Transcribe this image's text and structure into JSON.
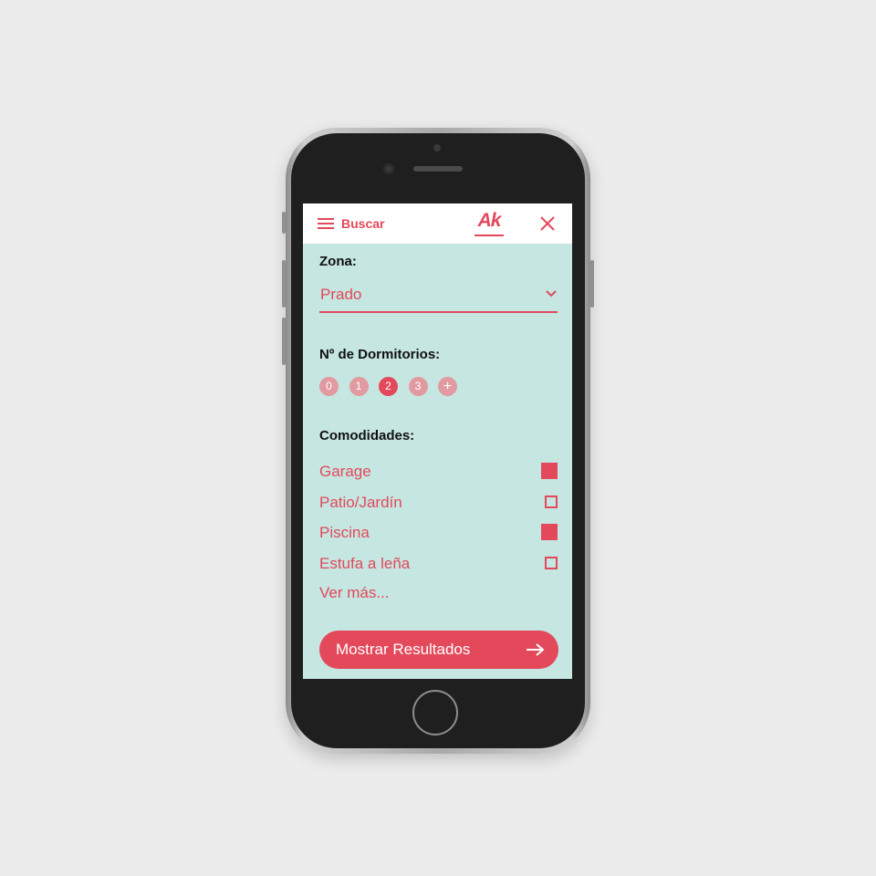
{
  "header": {
    "menu_label": "Buscar",
    "logo_text": "Ak",
    "menu_icon": "hamburger-icon",
    "close_icon": "close-icon",
    "accent_color": "#e3495b"
  },
  "zone": {
    "label": "Zona:",
    "selected": "Prado"
  },
  "rooms": {
    "label": "Nº de Dormitorios:",
    "options": [
      "0",
      "1",
      "2",
      "3",
      "+"
    ],
    "selected": "2"
  },
  "amenities": {
    "label": "Comodidades:",
    "items": [
      {
        "label": "Garage",
        "checked": true
      },
      {
        "label": "Patio/Jardín",
        "checked": false
      },
      {
        "label": "Piscina",
        "checked": true
      },
      {
        "label": "Estufa a leña",
        "checked": false
      }
    ],
    "see_more": "Ver más..."
  },
  "footer": {
    "results_button": "Mostrar Resultados",
    "results_icon": "arrow-right-icon"
  },
  "colors": {
    "screen_bg": "#c5e6e1",
    "accent": "#e3495b",
    "chip_inactive": "#e29aa1"
  }
}
